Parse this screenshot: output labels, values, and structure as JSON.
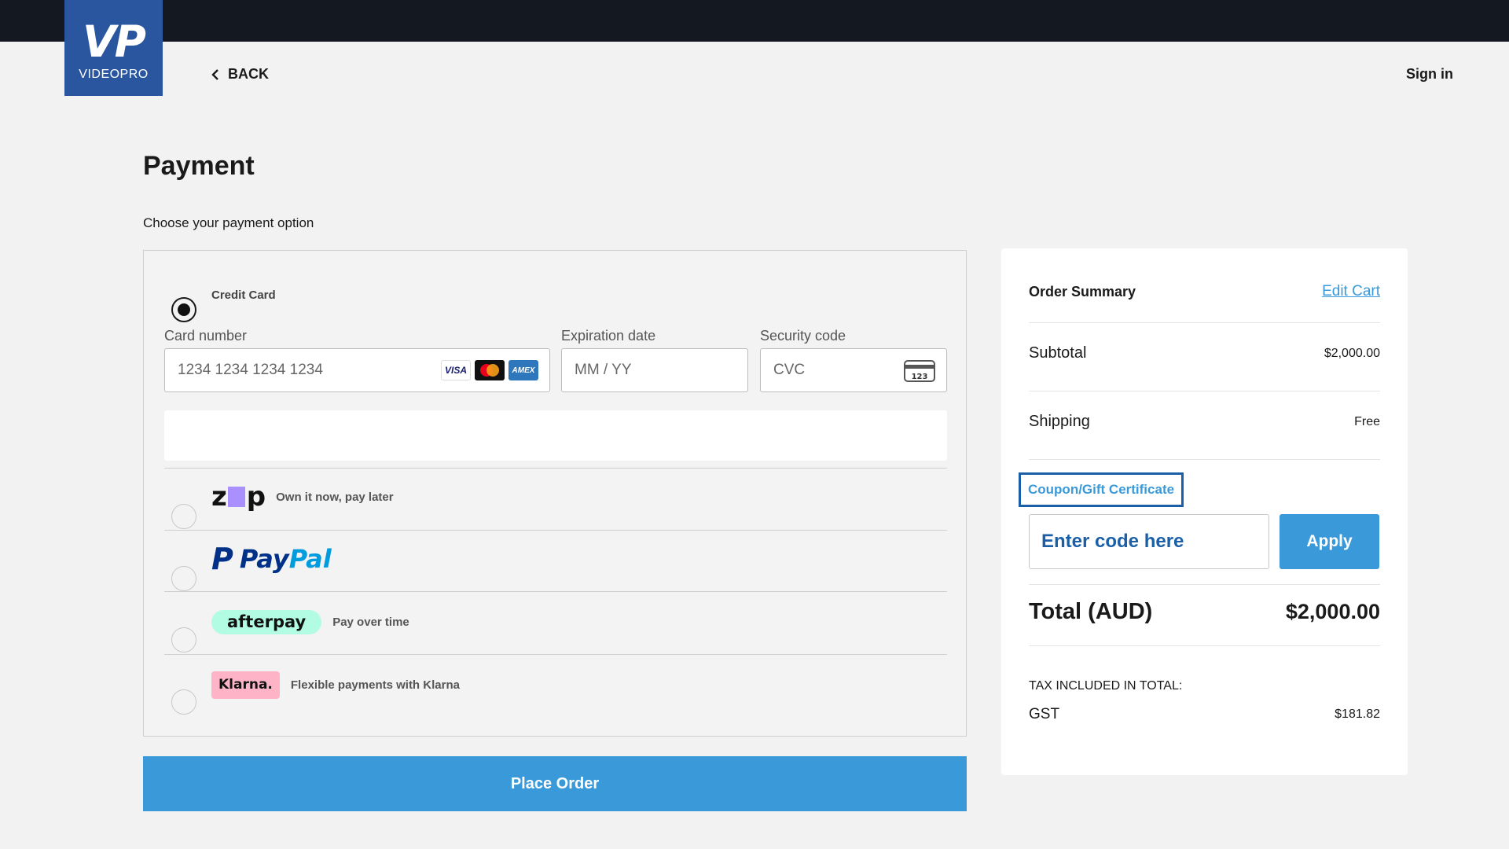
{
  "header": {
    "logo_main": "VP",
    "logo_sub": "VIDEOPRO",
    "back_label": "BACK",
    "signin_label": "Sign in"
  },
  "payment": {
    "title": "Payment",
    "subtitle": "Choose your payment option",
    "credit_card": {
      "label": "Credit Card",
      "selected": true,
      "card_number_label": "Card number",
      "card_number_placeholder": "1234 1234 1234 1234",
      "card_brands": [
        "VISA",
        "Mastercard",
        "AMEX"
      ],
      "expiry_label": "Expiration date",
      "expiry_placeholder": "MM / YY",
      "cvc_label": "Security code",
      "cvc_placeholder": "CVC",
      "cvc_icon_text": "123"
    },
    "methods": [
      {
        "id": "zip",
        "logo_text": "zip",
        "description": "Own it now, pay later",
        "selected": false
      },
      {
        "id": "paypal",
        "logo_text_1": "Pay",
        "logo_text_2": "Pal",
        "description": "",
        "selected": false
      },
      {
        "id": "afterpay",
        "logo_text": "afterpay",
        "description": "Pay over time",
        "selected": false
      },
      {
        "id": "klarna",
        "logo_text": "Klarna.",
        "description": "Flexible payments with Klarna",
        "selected": false
      }
    ],
    "place_order_label": "Place Order"
  },
  "summary": {
    "title": "Order Summary",
    "edit_cart_label": "Edit Cart",
    "subtotal_label": "Subtotal",
    "subtotal_value": "$2,000.00",
    "shipping_label": "Shipping",
    "shipping_value": "Free",
    "coupon_label": "Coupon/Gift Certificate",
    "coupon_placeholder": "Enter code here",
    "apply_label": "Apply",
    "total_label": "Total (AUD)",
    "total_value": "$2,000.00",
    "tax_heading": "TAX INCLUDED IN TOTAL:",
    "gst_label": "GST",
    "gst_value": "$181.82"
  },
  "colors": {
    "accent": "#3a9ad9",
    "topbar": "#141820",
    "logo_bg": "#2a56a0",
    "coupon_border": "#1a5fa8"
  }
}
